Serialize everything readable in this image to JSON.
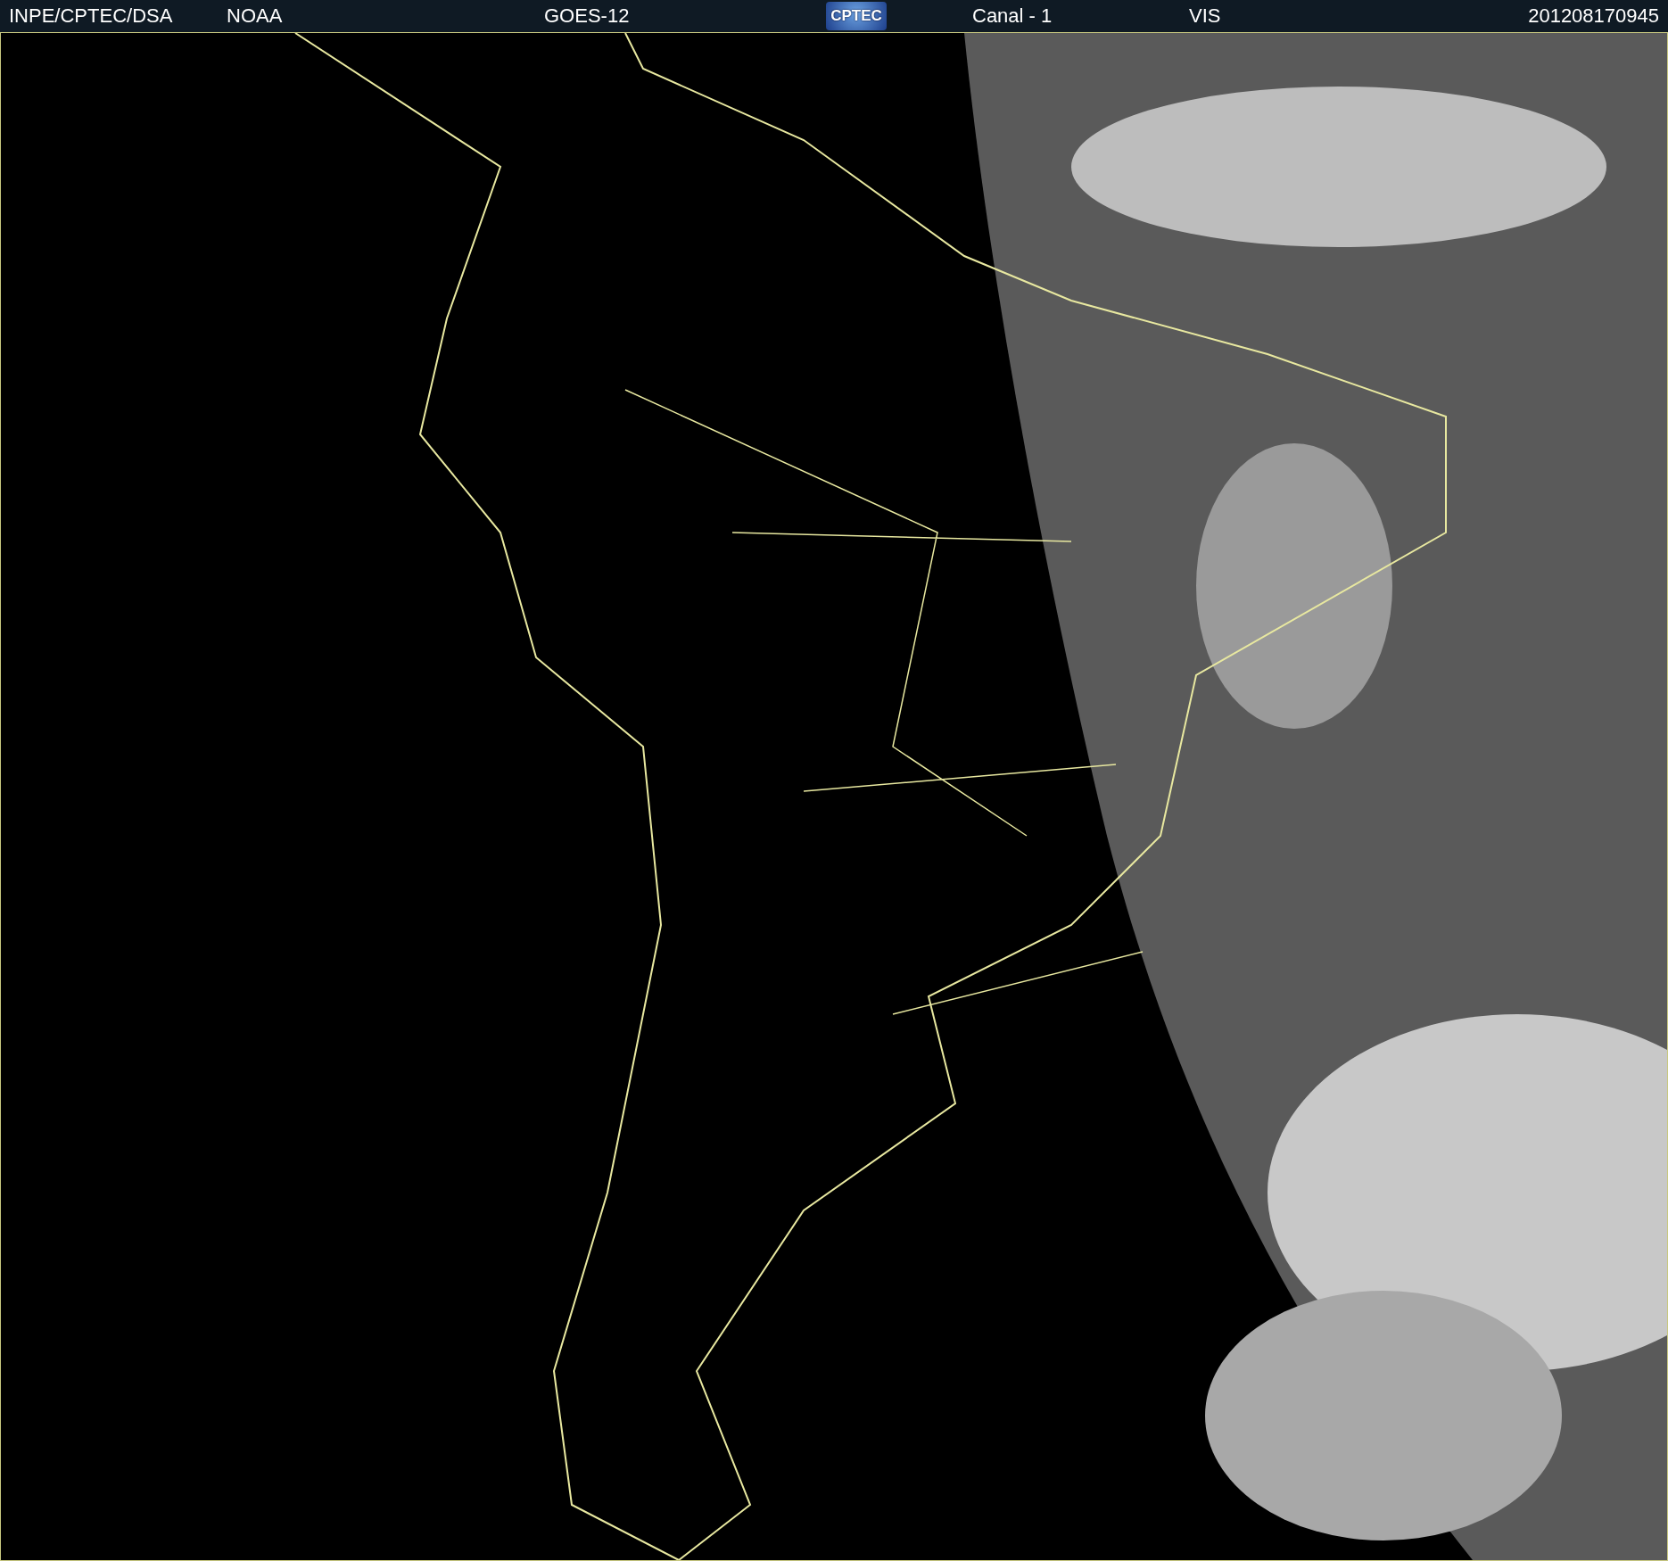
{
  "header": {
    "items": [
      {
        "kind": "text",
        "text": "INPE/CPTEC/DSA"
      },
      {
        "kind": "text",
        "text": "NOAA"
      },
      {
        "kind": "text",
        "text": "GOES-12"
      },
      {
        "kind": "logo",
        "text": "CPTEC"
      },
      {
        "kind": "text",
        "text": "Canal - 1"
      },
      {
        "kind": "text",
        "text": "VIS"
      },
      {
        "kind": "text",
        "text": "201208170945"
      }
    ]
  }
}
